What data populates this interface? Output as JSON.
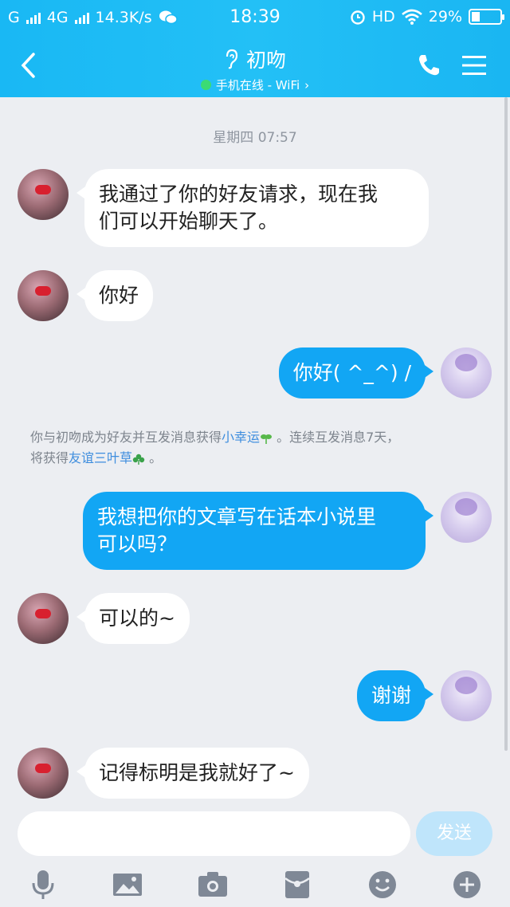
{
  "status_bar": {
    "carrier_left": "G",
    "network": "4G",
    "speed": "14.3K/s",
    "time": "18:39",
    "hd": "HD",
    "battery": "29%",
    "battery_level": 0.29,
    "icons": [
      "signal-icon",
      "wechat-icon",
      "alarm-icon",
      "wifi-icon",
      "battery-icon"
    ]
  },
  "header": {
    "title": "初吻",
    "subtitle": "手机在线 - WiFi",
    "online_color": "#3bdb74",
    "icons": [
      "back-icon",
      "ear-icon",
      "phone-icon",
      "menu-icon"
    ]
  },
  "chat": {
    "timestamp": "星期四 07:57",
    "messages": [
      {
        "side": "in",
        "lines": [
          "我通过了你的好友请求，现在我",
          "们可以开始聊天了。"
        ]
      },
      {
        "side": "in",
        "lines": [
          "你好"
        ]
      },
      {
        "side": "out",
        "lines": [
          "你好( ^_^) /"
        ]
      },
      {
        "side": "out",
        "lines": [
          "我想把你的文章写在话本小说里",
          "可以吗？"
        ]
      },
      {
        "side": "in",
        "lines": [
          "可以的~"
        ]
      },
      {
        "side": "out",
        "lines": [
          "谢谢"
        ]
      },
      {
        "side": "in",
        "lines": [
          "记得标明是我就好了~"
        ]
      }
    ],
    "notice": {
      "part1": "你与初吻成为好友并互发消息获得",
      "link1": "小幸运",
      "part2": " 。连续互发消息7天，",
      "part3": "将获得",
      "link2": "友谊三叶草",
      "part4": " 。"
    }
  },
  "composer": {
    "send_label": "发送",
    "tools": [
      "microphone-icon",
      "image-icon",
      "camera-icon",
      "red-packet-icon",
      "emoji-icon",
      "plus-icon"
    ]
  },
  "colors": {
    "header": "#19b8f4",
    "out_bubble": "#12a6f4",
    "in_bubble": "#ffffff",
    "background": "#eceef2",
    "link": "#3f8ede"
  }
}
